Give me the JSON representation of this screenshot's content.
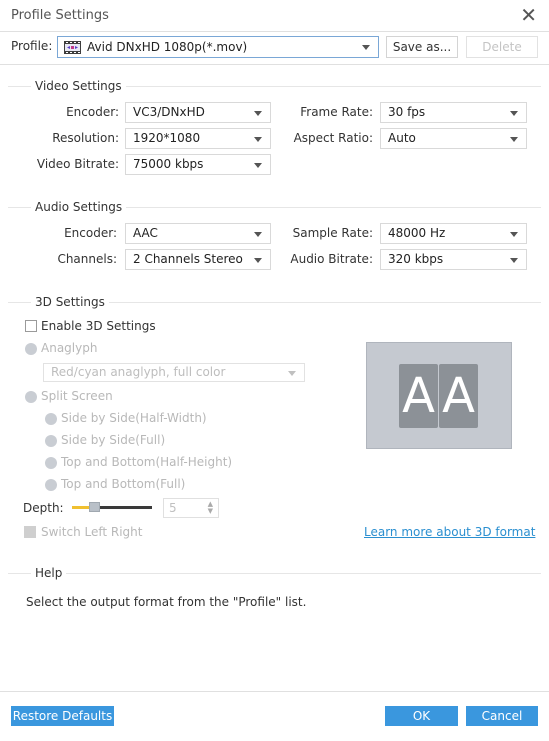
{
  "window": {
    "title": "Profile Settings",
    "close_icon": "close-icon"
  },
  "profile": {
    "label": "Profile:",
    "value": "Avid DNxHD 1080p(*.mov)",
    "icon": "film-icon",
    "save_as_label": "Save as...",
    "delete_label": "Delete",
    "delete_disabled": true
  },
  "video_settings": {
    "title": "Video Settings",
    "encoder": {
      "label": "Encoder:",
      "value": "VC3/DNxHD"
    },
    "resolution": {
      "label": "Resolution:",
      "value": " 1920*1080"
    },
    "video_bitrate": {
      "label": "Video Bitrate:",
      "value": "75000 kbps"
    },
    "frame_rate": {
      "label": "Frame Rate:",
      "value": "30 fps"
    },
    "aspect_ratio": {
      "label": "Aspect Ratio:",
      "value": " Auto"
    }
  },
  "audio_settings": {
    "title": "Audio Settings",
    "encoder": {
      "label": "Encoder:",
      "value": "AAC"
    },
    "channels": {
      "label": "Channels:",
      "value": "2 Channels Stereo"
    },
    "sample_rate": {
      "label": "Sample Rate:",
      "value": "48000 Hz"
    },
    "audio_bitrate": {
      "label": "Audio Bitrate:",
      "value": "320 kbps"
    }
  },
  "settings_3d": {
    "title": "3D Settings",
    "enable_label": "Enable 3D Settings",
    "enable_checked": false,
    "anaglyph_label": "Anaglyph",
    "anaglyph_mode": "Red/cyan anaglyph, full color",
    "split_screen_label": "Split Screen",
    "split_options": [
      "Side by Side(Half-Width)",
      "Side by Side(Full)",
      "Top and Bottom(Half-Height)",
      "Top and Bottom(Full)"
    ],
    "depth_label": "Depth:",
    "depth_value": "5",
    "switch_label": "Switch Left Right",
    "preview_letters": [
      "A",
      "A"
    ],
    "learn_more_link": "Learn more about 3D format"
  },
  "help": {
    "title": "Help",
    "text": "Select the output format from the \"Profile\" list."
  },
  "footer": {
    "restore_label": "Restore Defaults",
    "ok_label": "OK",
    "cancel_label": "Cancel"
  },
  "colors": {
    "accent": "#3a97de",
    "link": "#2a8fd0",
    "slider_fill": "#f0c030"
  }
}
